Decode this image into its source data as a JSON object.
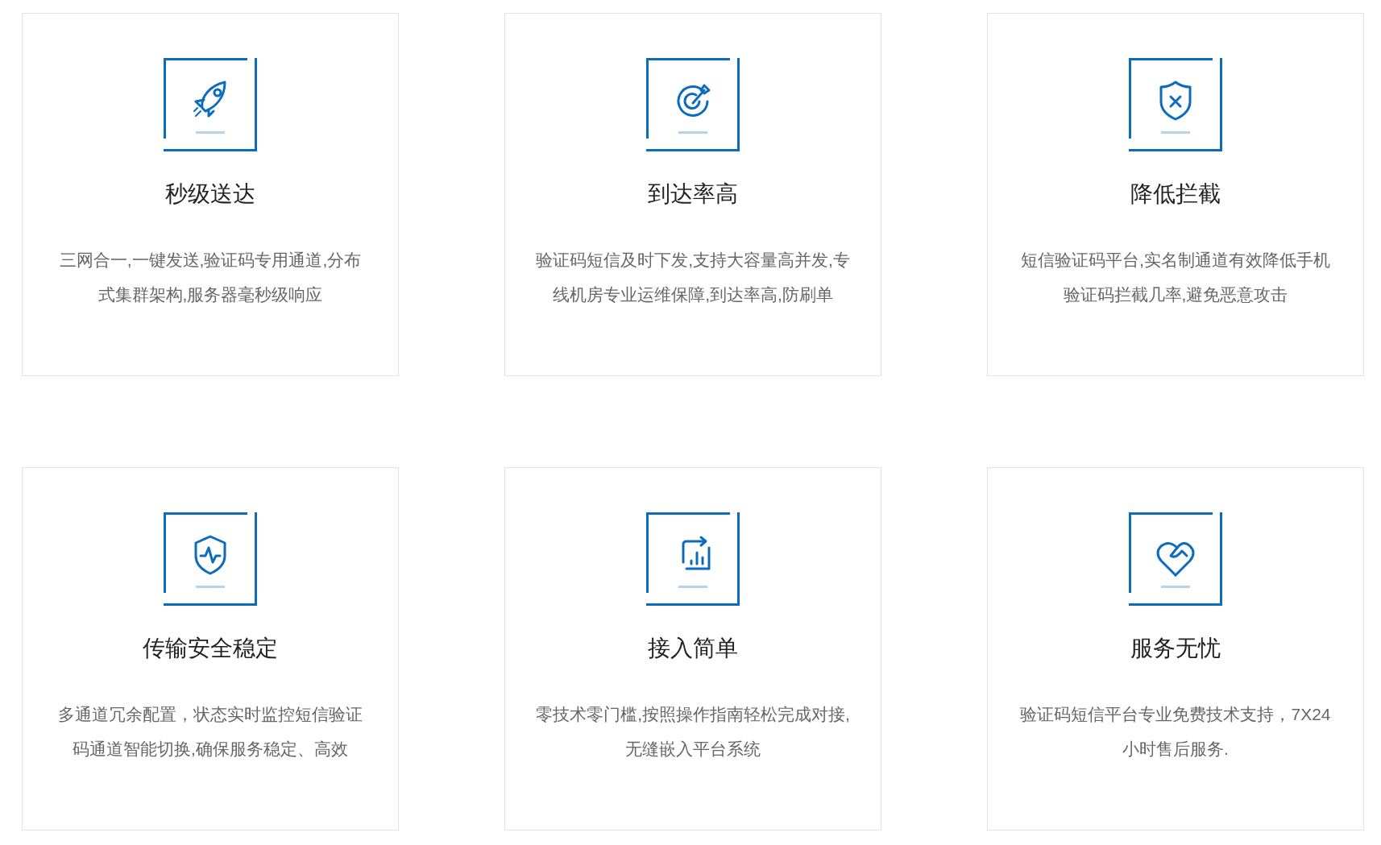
{
  "features": [
    {
      "title": "秒级送达",
      "description": "三网合一,一键发送,验证码专用通道,分布式集群架构,服务器毫秒级响应"
    },
    {
      "title": "到达率高",
      "description": "验证码短信及时下发,支持大容量高并发,专线机房专业运维保障,到达率高,防刷单"
    },
    {
      "title": "降低拦截",
      "description": "短信验证码平台,实名制通道有效降低手机验证码拦截几率,避免恶意攻击"
    },
    {
      "title": "传输安全稳定",
      "description": "多通道冗余配置，状态实时监控短信验证码通道智能切换,确保服务稳定、高效"
    },
    {
      "title": "接入简单",
      "description": "零技术零门槛,按照操作指南轻松完成对接,无缝嵌入平台系统"
    },
    {
      "title": "服务无忧",
      "description": "验证码短信平台专业免费技术支持，7X24小时售后服务."
    }
  ]
}
